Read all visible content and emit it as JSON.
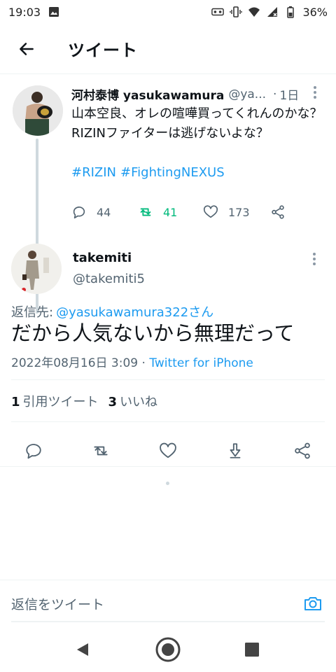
{
  "status_bar": {
    "time": "19:03",
    "battery": "36%",
    "icons": [
      "image-notification-icon",
      "voicemail-icon",
      "vibrate-icon",
      "wifi-icon",
      "signal-icon",
      "battery-icon"
    ]
  },
  "header": {
    "title": "ツイート"
  },
  "parent_tweet": {
    "display_name": "河村泰博 yasukawamura",
    "handle": "@ya...",
    "separator": "·",
    "age": "1日",
    "text_lines": [
      "山本空良、オレの喧嘩買ってくれんのかな？",
      "RIZINファイターは逃げないよな？"
    ],
    "hashtags": [
      "#RIZIN",
      "#FightingNEXUS"
    ],
    "reply_count": "44",
    "retweet_count": "41",
    "like_count": "173"
  },
  "main_tweet": {
    "display_name": "takemiti",
    "handle": "@takemiti5",
    "replying_label": "返信先:",
    "replying_to": "@yasukawamura322さん",
    "text": "だから人気ないから無理だって",
    "timestamp": "2022年08月16日 3:09",
    "meta_separator": "·",
    "source": "Twitter for iPhone",
    "quote_count": "1",
    "quote_label": "引用ツイート",
    "like_count": "3",
    "like_label": "いいね"
  },
  "reply_bar": {
    "placeholder": "返信をツイート"
  },
  "colors": {
    "accent": "#1d9bf0",
    "retweet": "#00ba7c",
    "muted": "#536471",
    "divider": "#eff3f4"
  }
}
